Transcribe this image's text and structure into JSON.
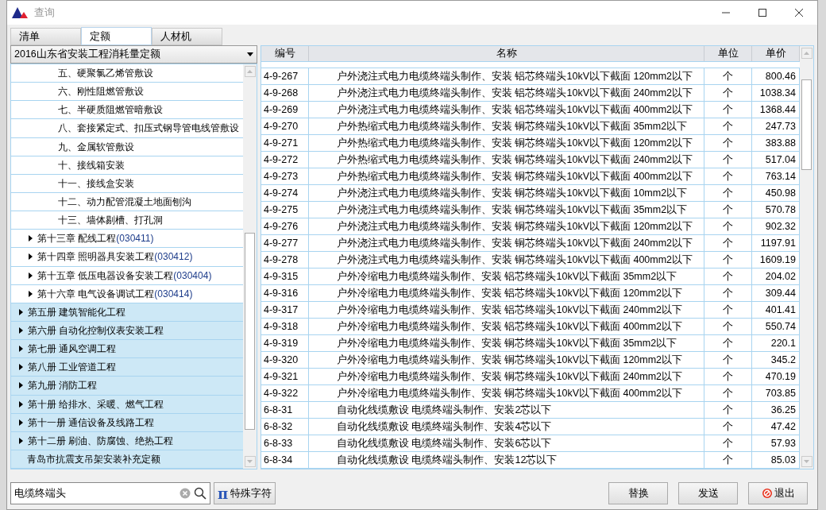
{
  "window": {
    "title": "查询"
  },
  "tabs": [
    {
      "label": "清单",
      "selected": false
    },
    {
      "label": "定额",
      "selected": true
    },
    {
      "label": "人材机",
      "selected": false
    }
  ],
  "library_select": {
    "value": "2016山东省安装工程消耗量定额"
  },
  "tree": [
    {
      "children": [
        {
          "children": [
            {
              "label": "五、硬聚氯乙烯管敷设"
            },
            {
              "label": "六、刚性阻燃管敷设"
            },
            {
              "label": "七、半硬质阻燃管暗敷设"
            },
            {
              "label": "八、套接紧定式、扣压式钢导管电线管敷设"
            },
            {
              "label": "九、金属软管敷设"
            },
            {
              "label": "十、接线箱安装"
            },
            {
              "label": "十一、接线盒安装"
            },
            {
              "label": "十二、动力配管混凝土地面刨沟"
            },
            {
              "label": "十三、墙体剔槽、打孔洞"
            }
          ]
        },
        {
          "label": "第十三章 配线工程",
          "code": "(030411)",
          "expanded": false
        },
        {
          "label": "第十四章 照明器具安装工程",
          "code": "(030412)",
          "expanded": false
        },
        {
          "label": "第十五章  低压电器设备安装工程",
          "code": "(030404)",
          "expanded": false
        },
        {
          "label": "第十六章 电气设备调试工程",
          "code": "(030414)",
          "expanded": false
        }
      ]
    },
    {
      "label": "第五册  建筑智能化工程",
      "expanded": false
    },
    {
      "label": "第六册  自动化控制仪表安装工程",
      "expanded": false
    },
    {
      "label": "第七册 通风空调工程",
      "expanded": false
    },
    {
      "label": "第八册 工业管道工程",
      "expanded": false
    },
    {
      "label": "第九册 消防工程",
      "expanded": false
    },
    {
      "label": "第十册 给排水、采暖、燃气工程",
      "expanded": false
    },
    {
      "label": "第十一册 通信设备及线路工程",
      "expanded": false
    },
    {
      "label": "第十二册 刷油、防腐蚀、绝热工程",
      "expanded": false
    },
    {
      "label": "青岛市抗震支吊架安装补充定额"
    }
  ],
  "table": {
    "columns": [
      "编号",
      "名称",
      "单位",
      "单价"
    ],
    "rows": [
      [
        "4-9-267",
        "户外浇注式电力电缆终端头制作、安装 铝芯终端头10kV以下截面 120mm2以下",
        "个",
        "800.46"
      ],
      [
        "4-9-268",
        "户外浇注式电力电缆终端头制作、安装 铝芯终端头10kV以下截面 240mm2以下",
        "个",
        "1038.34"
      ],
      [
        "4-9-269",
        "户外浇注式电力电缆终端头制作、安装 铝芯终端头10kV以下截面 400mm2以下",
        "个",
        "1368.44"
      ],
      [
        "4-9-270",
        "户外热缩式电力电缆终端头制作、安装 铜芯终端头10kV以下截面 35mm2以下",
        "个",
        "247.73"
      ],
      [
        "4-9-271",
        "户外热缩式电力电缆终端头制作、安装 铜芯终端头10kV以下截面 120mm2以下",
        "个",
        "383.88"
      ],
      [
        "4-9-272",
        "户外热缩式电力电缆终端头制作、安装 铜芯终端头10kV以下截面 240mm2以下",
        "个",
        "517.04"
      ],
      [
        "4-9-273",
        "户外热缩式电力电缆终端头制作、安装 铜芯终端头10kV以下截面 400mm2以下",
        "个",
        "763.14"
      ],
      [
        "4-9-274",
        "户外浇注式电力电缆终端头制作、安装 铜芯终端头10kV以下截面 10mm2以下",
        "个",
        "450.98"
      ],
      [
        "4-9-275",
        "户外浇注式电力电缆终端头制作、安装 铜芯终端头10kV以下截面 35mm2以下",
        "个",
        "570.78"
      ],
      [
        "4-9-276",
        "户外浇注式电力电缆终端头制作、安装 铜芯终端头10kV以下截面 120mm2以下",
        "个",
        "902.32"
      ],
      [
        "4-9-277",
        "户外浇注式电力电缆终端头制作、安装 铜芯终端头10kV以下截面 240mm2以下",
        "个",
        "1197.91"
      ],
      [
        "4-9-278",
        "户外浇注式电力电缆终端头制作、安装 铜芯终端头10kV以下截面 400mm2以下",
        "个",
        "1609.19"
      ],
      [
        "4-9-315",
        "户外冷缩电力电缆终端头制作、安装 铝芯终端头10kV以下截面 35mm2以下",
        "个",
        "204.02"
      ],
      [
        "4-9-316",
        "户外冷缩电力电缆终端头制作、安装 铝芯终端头10kV以下截面 120mm2以下",
        "个",
        "309.44"
      ],
      [
        "4-9-317",
        "户外冷缩电力电缆终端头制作、安装 铝芯终端头10kV以下截面 240mm2以下",
        "个",
        "401.41"
      ],
      [
        "4-9-318",
        "户外冷缩电力电缆终端头制作、安装 铝芯终端头10kV以下截面 400mm2以下",
        "个",
        "550.74"
      ],
      [
        "4-9-319",
        "户外冷缩电力电缆终端头制作、安装 铜芯终端头10kV以下截面 35mm2以下",
        "个",
        "220.1"
      ],
      [
        "4-9-320",
        "户外冷缩电力电缆终端头制作、安装 铜芯终端头10kV以下截面 120mm2以下",
        "个",
        "345.2"
      ],
      [
        "4-9-321",
        "户外冷缩电力电缆终端头制作、安装 铜芯终端头10kV以下截面 240mm2以下",
        "个",
        "470.19"
      ],
      [
        "4-9-322",
        "户外冷缩电力电缆终端头制作、安装 铜芯终端头10kV以下截面 400mm2以下",
        "个",
        "703.85"
      ],
      [
        "6-8-31",
        "自动化线缆敷设 电缆终端头制作、安装2芯以下",
        "个",
        "36.25"
      ],
      [
        "6-8-32",
        "自动化线缆敷设 电缆终端头制作、安装4芯以下",
        "个",
        "47.42"
      ],
      [
        "6-8-33",
        "自动化线缆敷设 电缆终端头制作、安装6芯以下",
        "个",
        "57.93"
      ],
      [
        "6-8-34",
        "自动化线缆敷设 电缆终端头制作、安装12芯以下",
        "个",
        "85.03"
      ]
    ]
  },
  "search": {
    "value": "电缆终端头"
  },
  "special_chars_button": {
    "icon": "π",
    "label": "特殊字符"
  },
  "buttons": [
    {
      "kind": "plain",
      "label": "替换"
    },
    {
      "kind": "plain",
      "label": "发送"
    },
    {
      "kind": "exit",
      "label": "退出"
    }
  ]
}
